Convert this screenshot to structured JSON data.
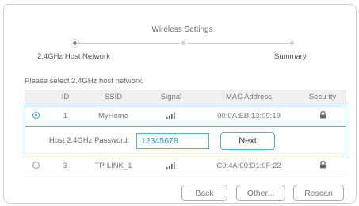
{
  "stepper": {
    "title": "Wireless Settings",
    "step1_label": "2.4GHz Host Network",
    "step3_label": "Summary"
  },
  "instruction": "Please select 2.4GHz host network.",
  "table": {
    "headers": {
      "id": "ID",
      "ssid": "SSID",
      "signal": "Signal",
      "mac": "MAC Address",
      "security": "Security"
    },
    "rows": [
      {
        "id": "1",
        "ssid": "MyHome",
        "signal_icon": "signal-bars-icon",
        "mac": "00:0A:EB:13:09:19",
        "security_icon": "lock-icon",
        "selected": true
      },
      {
        "id": "3",
        "ssid": "TP-LINK_1",
        "signal_icon": "signal-bars-icon",
        "mac": "C0:4A:00:D1:0F:22",
        "security_icon": "lock-icon",
        "selected": false
      }
    ],
    "password": {
      "label": "Host 2.4GHz Password:",
      "value": "12345678",
      "next_label": "Next"
    }
  },
  "buttons": {
    "back": "Back",
    "other": "Other...",
    "rescan": "Rescan"
  },
  "colors": {
    "accent": "#4ab4dd",
    "border": "#cfcfcf",
    "header_bg": "#f0f0f0"
  }
}
